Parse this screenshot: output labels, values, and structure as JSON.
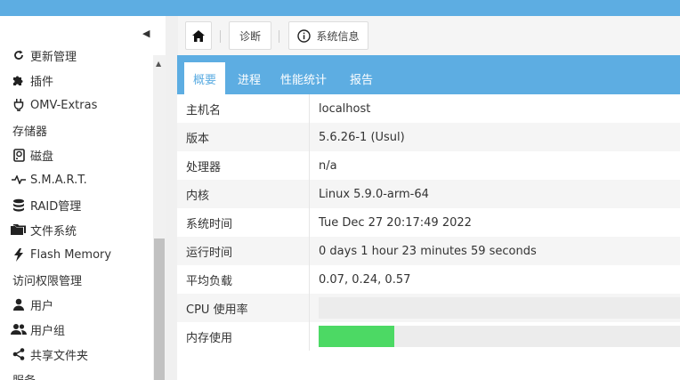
{
  "sidebar": {
    "items": [
      {
        "label": "更新管理",
        "icon": "update-icon",
        "kind": "sub"
      },
      {
        "label": "插件",
        "icon": "puzzle-icon",
        "kind": "sub"
      },
      {
        "label": "OMV-Extras",
        "icon": "plug-icon",
        "kind": "sub"
      },
      {
        "label": "存储器",
        "icon": "",
        "kind": "section"
      },
      {
        "label": "磁盘",
        "icon": "harddisk-icon",
        "kind": "sub"
      },
      {
        "label": "S.M.A.R.T.",
        "icon": "pulse-icon",
        "kind": "sub"
      },
      {
        "label": "RAID管理",
        "icon": "database-icon",
        "kind": "sub"
      },
      {
        "label": "文件系统",
        "icon": "folders-icon",
        "kind": "sub"
      },
      {
        "label": "Flash Memory",
        "icon": "flash-icon",
        "kind": "sub"
      },
      {
        "label": "访问权限管理",
        "icon": "",
        "kind": "section"
      },
      {
        "label": "用户",
        "icon": "user-icon",
        "kind": "sub"
      },
      {
        "label": "用户组",
        "icon": "users-icon",
        "kind": "sub"
      },
      {
        "label": "共享文件夹",
        "icon": "share-icon",
        "kind": "sub"
      },
      {
        "label": "服务",
        "icon": "",
        "kind": "section"
      }
    ]
  },
  "toolbar": {
    "home_icon": "home-icon",
    "breadcrumb_diag": "诊断",
    "breadcrumb_sysinfo": "系统信息",
    "info_icon": "info-icon"
  },
  "tabs": [
    "概要",
    "进程",
    "性能统计",
    "报告"
  ],
  "active_tab": "概要",
  "overview": {
    "rows": [
      {
        "name": "主机名",
        "value": "localhost"
      },
      {
        "name": "版本",
        "value": "5.6.26-1 (Usul)"
      },
      {
        "name": "处理器",
        "value": "n/a"
      },
      {
        "name": "内核",
        "value": "Linux 5.9.0-arm-64"
      },
      {
        "name": "系统时间",
        "value": "Tue Dec 27 20:17:49 2022"
      },
      {
        "name": "运行时间",
        "value": "0 days 1 hour 23 minutes 59 seconds"
      },
      {
        "name": "平均负载",
        "value": "0.07, 0.24, 0.57"
      }
    ],
    "cpu_label": "CPU 使用率",
    "cpu_usage_percent": 0,
    "mem_label": "内存使用",
    "mem_usage_percent": 21
  },
  "colors": {
    "accent": "#5dade2",
    "bar_fill": "#4cd964",
    "bar_track": "#ececec"
  }
}
